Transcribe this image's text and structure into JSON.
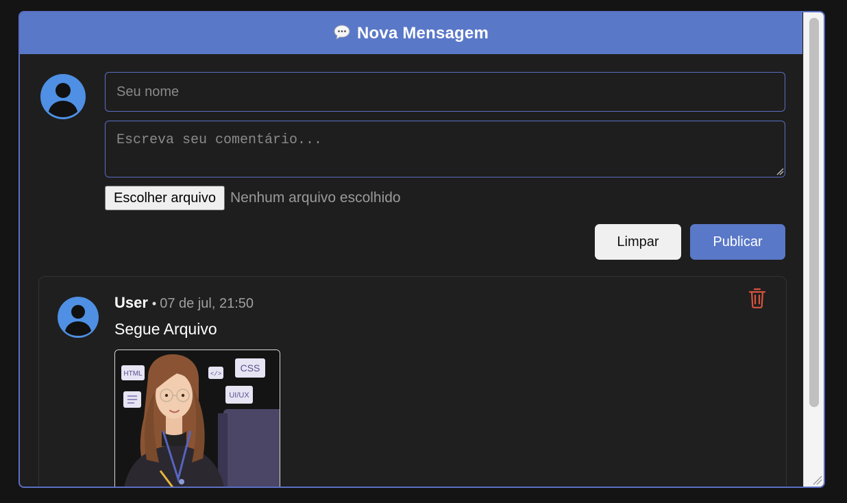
{
  "header": {
    "title": "Nova Mensagem",
    "icon": "speech-bubble-icon"
  },
  "composer": {
    "name_placeholder": "Seu nome",
    "comment_placeholder": "Escreva seu comentário...",
    "file_button_label": "Escolher arquivo",
    "file_status": "Nenhum arquivo escolhido",
    "clear_label": "Limpar",
    "publish_label": "Publicar"
  },
  "comments": [
    {
      "author": "User",
      "separator": "•",
      "timestamp": "07 de jul, 21:50",
      "text": "Segue Arquivo",
      "attachment_labels": [
        "HTML",
        "</>",
        "CSS",
        "UI/UX"
      ]
    }
  ],
  "colors": {
    "accent": "#5a78c8",
    "avatar": "#4f90e4",
    "delete": "#d9533e",
    "background": "#1e1e1e"
  }
}
